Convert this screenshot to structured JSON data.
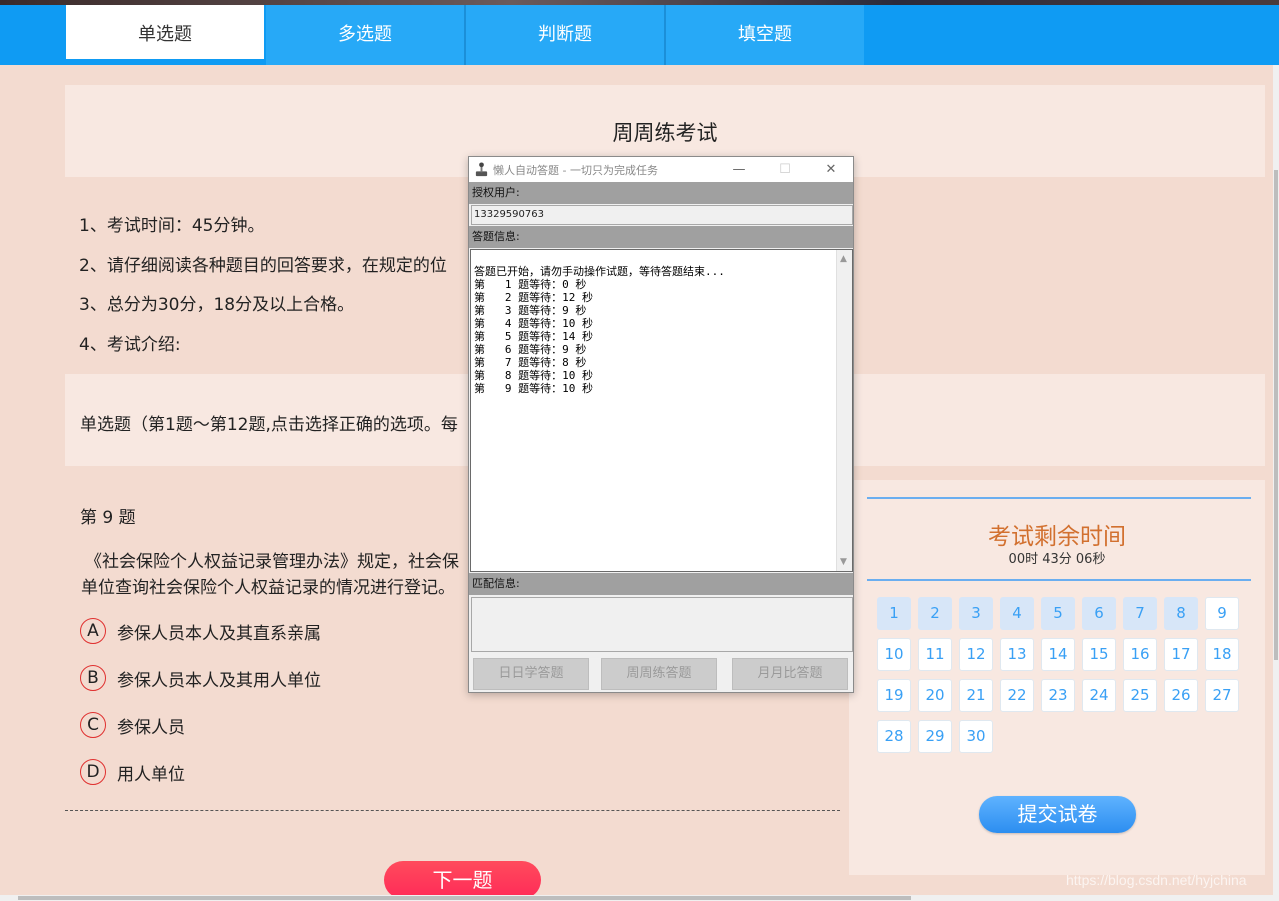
{
  "tabs": [
    {
      "label": "单选题",
      "active": true
    },
    {
      "label": "多选题",
      "active": false
    },
    {
      "label": "判断题",
      "active": false
    },
    {
      "label": "填空题",
      "active": false
    }
  ],
  "exam": {
    "title": "周周练考试",
    "rules": [
      "1、考试时间：45分钟。",
      "2、请仔细阅读各种题目的回答要求，在规定的位",
      "3、总分为30分，18分及以上合格。",
      "4、考试介绍:"
    ],
    "section_text": "单选题（第1题～第12题,点击选择正确的选项。每"
  },
  "question": {
    "number_label": "第 9 题",
    "text_line1": "《社会保险个人权益记录管理办法》规定，社会保",
    "text_line2": "单位查询社会保险个人权益记录的情况进行登记。",
    "options": [
      {
        "letter": "A",
        "text": "参保人员本人及其直系亲属"
      },
      {
        "letter": "B",
        "text": "参保人员本人及其用人单位"
      },
      {
        "letter": "C",
        "text": "参保人员"
      },
      {
        "letter": "D",
        "text": "用人单位"
      }
    ]
  },
  "next_button": "下一题",
  "timer": {
    "title": "考试剩余时间",
    "value": "00时 43分 06秒"
  },
  "question_grid": {
    "numbers": [
      "1",
      "2",
      "3",
      "4",
      "5",
      "6",
      "7",
      "8",
      "9",
      "10",
      "11",
      "12",
      "13",
      "14",
      "15",
      "16",
      "17",
      "18",
      "19",
      "20",
      "21",
      "22",
      "23",
      "24",
      "25",
      "26",
      "27",
      "28",
      "29",
      "30"
    ],
    "answered_count": 8
  },
  "submit_button": "提交试卷",
  "watermark": "https://blog.csdn.net/hyjchina",
  "app_window": {
    "title": "懒人自动答题 - 一切只为完成任务",
    "controls": {
      "minimize": "—",
      "maximize": "☐",
      "close": "✕"
    },
    "user_label": "授权用户:",
    "user_value": "13329590763",
    "info_label": "答题信息:",
    "log": [
      "答题已开始，请勿手动操作试题，等待答题结束...",
      "第   1 题等待：0 秒",
      "第   2 题等待：12 秒",
      "第   3 题等待：9 秒",
      "第   4 题等待：10 秒",
      "第   5 题等待：14 秒",
      "第   6 题等待：9 秒",
      "第   7 题等待：8 秒",
      "第   8 题等待：10 秒",
      "第   9 题等待：10 秒"
    ],
    "match_label": "匹配信息:",
    "buttons": [
      "日日学答题",
      "周周练答题",
      "月月比答题"
    ]
  }
}
